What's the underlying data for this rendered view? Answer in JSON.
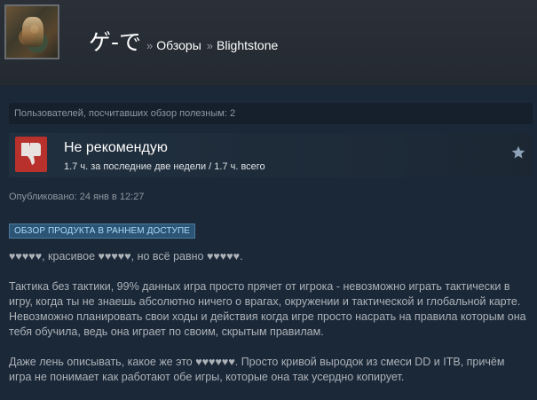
{
  "header": {
    "username": "ゲ-で",
    "separator": "»",
    "reviews_label": "Обзоры",
    "game_title": "Blightstone"
  },
  "review": {
    "helpful_text": "Пользователей, посчитавших обзор полезным: 2",
    "verdict": "Не рекомендую",
    "hours": "1.7 ч. за последние две недели / 1.7 ч. всего",
    "posted": "Опубликовано: 24 янв в 12:27",
    "early_access_badge": "ОБЗОР ПРОДУКТА В РАННЕМ ДОСТУПЕ",
    "paragraphs": [
      "♥♥♥♥♥, красивое ♥♥♥♥♥, но всё равно ♥♥♥♥♥.",
      "Тактика без тактики, 99% данных игра просто прячет от игрока - невозможно играть тактически в игру, когда ты не знаешь абсолютно ничего о врагах, окружении и тактической и глобальной карте. Невозможно планировать свои ходы и действия когда игре просто насрать на правила которым она тебя обучила, ведь она играет по своим, скрытым правилам.",
      "Даже лень описывать, какое же это ♥♥♥♥♥♥. Просто кривой выродок из смеси DD и ITB, причём игра не понимает как работают обе игры, которые она так усердно копирует."
    ]
  },
  "icons": {
    "avatar": "user-avatar",
    "thumb": "thumbs-down-icon",
    "star": "star-icon"
  },
  "colors": {
    "background": "#1b2838",
    "thumb_red": "#b8312d",
    "badge_bg": "#2b5475",
    "star": "#8f98a0"
  }
}
